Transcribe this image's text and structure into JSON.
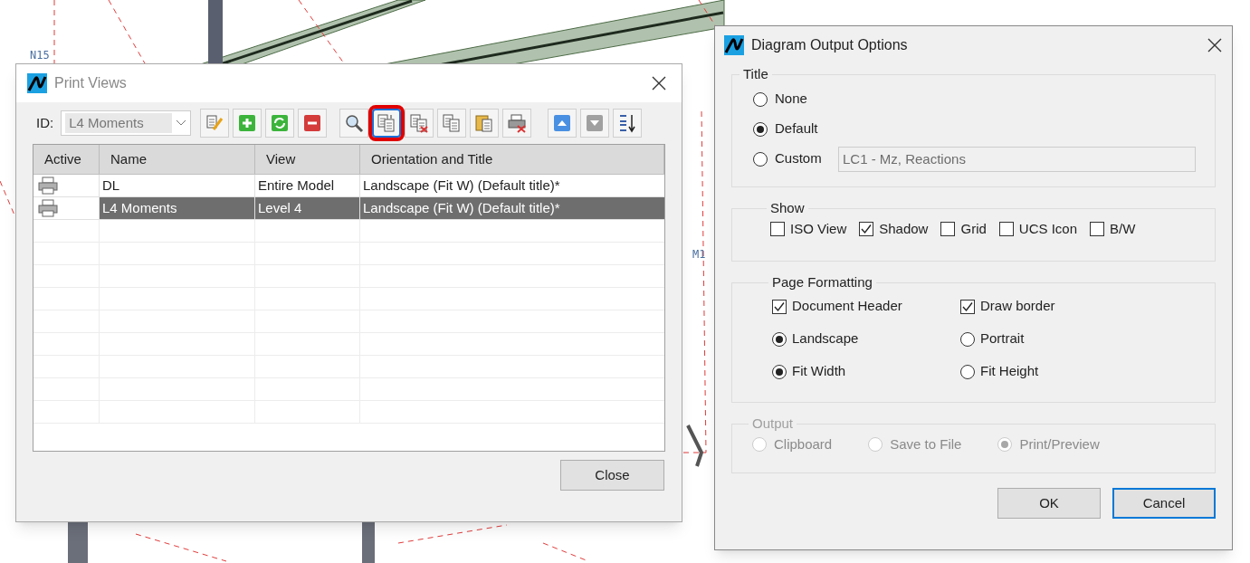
{
  "background": {
    "labels": [
      {
        "text": "N15"
      },
      {
        "text": "M1"
      }
    ]
  },
  "print_views": {
    "title": "Print Views",
    "id_label": "ID:",
    "id_value": "L4 Moments",
    "toolbar": [
      {
        "buttons": [
          {
            "kind": "edit",
            "highlighted": false
          },
          {
            "kind": "add",
            "highlighted": false
          },
          {
            "kind": "refresh",
            "highlighted": false
          },
          {
            "kind": "remove",
            "highlighted": false
          }
        ]
      },
      {
        "buttons": [
          {
            "kind": "search",
            "highlighted": false
          },
          {
            "kind": "copy-in",
            "highlighted": true
          },
          {
            "kind": "copy-out",
            "highlighted": false
          },
          {
            "kind": "copy",
            "highlighted": false
          },
          {
            "kind": "paste",
            "highlighted": false
          },
          {
            "kind": "print-delete",
            "highlighted": false
          }
        ]
      },
      {
        "buttons": [
          {
            "kind": "up",
            "highlighted": false
          },
          {
            "kind": "down",
            "highlighted": false
          },
          {
            "kind": "sort",
            "highlighted": false
          }
        ]
      }
    ],
    "columns": [
      "Active",
      "Name",
      "View",
      "Orientation and Title"
    ],
    "rows": [
      {
        "name": "DL",
        "view": "Entire Model",
        "orientation": "Landscape (Fit W) (Default title)*",
        "selected": false
      },
      {
        "name": "L4 Moments",
        "view": "Level 4",
        "orientation": "Landscape (Fit W) (Default title)*",
        "selected": true
      }
    ],
    "close_button": "Close"
  },
  "diagram_options": {
    "title": "Diagram Output Options",
    "title_group": {
      "label": "Title",
      "options": [
        {
          "label": "None",
          "selected": false
        },
        {
          "label": "Default",
          "selected": true
        },
        {
          "label": "Custom",
          "selected": false
        }
      ],
      "custom_value": "LC1 - Mz, Reactions"
    },
    "show_group": {
      "label": "Show",
      "options": [
        {
          "label": "ISO View",
          "checked": false
        },
        {
          "label": "Shadow",
          "checked": true
        },
        {
          "label": "Grid",
          "checked": false
        },
        {
          "label": "UCS Icon",
          "checked": false
        },
        {
          "label": "B/W",
          "checked": false
        }
      ]
    },
    "page_formatting": {
      "label": "Page Formatting",
      "items": [
        {
          "kind": "checkbox",
          "label": "Document Header",
          "checked": true
        },
        {
          "kind": "checkbox",
          "label": "Draw border",
          "checked": true
        },
        {
          "kind": "radio",
          "label": "Landscape",
          "selected": true
        },
        {
          "kind": "radio",
          "label": "Portrait",
          "selected": false
        },
        {
          "kind": "radio",
          "label": "Fit Width",
          "selected": true
        },
        {
          "kind": "radio",
          "label": "Fit Height",
          "selected": false
        }
      ]
    },
    "output_group": {
      "label": "Output",
      "disabled": true,
      "options": [
        {
          "label": "Clipboard",
          "selected": false
        },
        {
          "label": "Save to File",
          "selected": false
        },
        {
          "label": "Print/Preview",
          "selected": true
        }
      ]
    },
    "buttons": [
      {
        "label": "OK",
        "default": false
      },
      {
        "label": "Cancel",
        "default": true
      }
    ]
  }
}
